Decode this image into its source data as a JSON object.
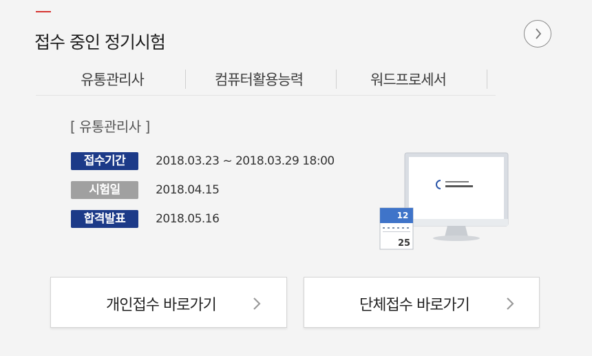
{
  "section": {
    "title": "접수 중인 정기시험",
    "more_icon": "chevron-right-circle-icon"
  },
  "tabs": [
    {
      "label": "유통관리사"
    },
    {
      "label": "컴퓨터활용능력"
    },
    {
      "label": "워드프로세서"
    }
  ],
  "exam": {
    "name": "[ 유통관리사 ]",
    "rows": [
      {
        "badge": "접수기간",
        "value": "2018.03.23 ~ 2018.03.29 18:00",
        "color": "#1c3a88"
      },
      {
        "badge": "시험일",
        "value": "2018.04.15",
        "color": "#a0a0a0"
      },
      {
        "badge": "합격발표",
        "value": "2018.05.16",
        "color": "#1c3a88"
      }
    ]
  },
  "illustration": {
    "calendar_top": "12",
    "calendar_bottom": "25",
    "icon": "calendar-monitor-icon"
  },
  "buttons": {
    "individual": "개인접수 바로가기",
    "group": "단체접수 바로가기",
    "chevron_icon": "chevron-right-icon"
  },
  "colors": {
    "accent": "#d6322f",
    "badge_navy": "#1c3a88",
    "badge_gray": "#a0a0a0"
  }
}
